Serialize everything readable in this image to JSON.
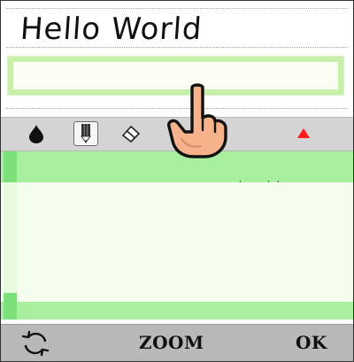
{
  "header": {
    "title": "Hello World"
  },
  "text_input": {
    "value": ""
  },
  "toolbar": {
    "tools": [
      {
        "name": "ink-drop-icon",
        "selected": false
      },
      {
        "name": "pencil-icon",
        "selected": true
      },
      {
        "name": "eraser-icon",
        "selected": false
      },
      {
        "name": "warning-triangle-icon",
        "color": "#ff1a1a"
      }
    ]
  },
  "bottom_bar": {
    "rotate_icon": "refresh-icon",
    "zoom_label": "ZOOM",
    "ok_label": "OK"
  },
  "colors": {
    "input_border": "#c8f0ab",
    "canvas_band": "#a8f0a0",
    "canvas_bg": "#f4fdee",
    "toolbar_bg": "#d4d4d4",
    "bottom_bar_bg": "#b9b9b9",
    "triangle": "#ff1a1a"
  }
}
